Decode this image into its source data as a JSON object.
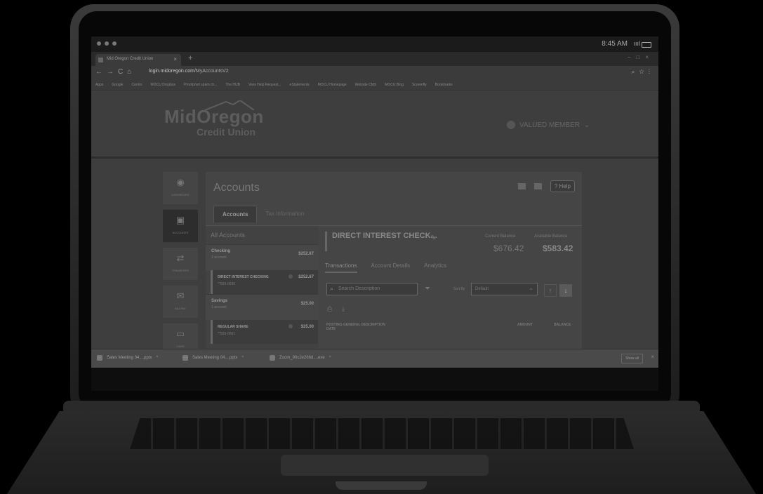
{
  "os": {
    "time": "8:45 AM",
    "signal": "ıııl"
  },
  "browser": {
    "tab_title": "Mid Oregon Credit Union",
    "tab_close": "×",
    "new_tab": "+",
    "url_host": "login.midoregon.com",
    "url_path": "/MyAccountsV2",
    "bookmarks": [
      "Apps",
      "Google",
      "Centro",
      "MOCU Dropbox",
      "Proofpoint spam ch...",
      "The HUB",
      "View Help Request...",
      "eStatements",
      "MOCU Homepage",
      "Website CMS",
      "MOCU Blog",
      "Screenfly",
      "Bookmarks"
    ]
  },
  "header": {
    "logo_line1": "MidOregon",
    "logo_line2": "Credit Union",
    "member_label": "VALUED MEMBER",
    "member_chevron": "⌄"
  },
  "sidenav": [
    {
      "label": "DASHBOARD",
      "icon": "◉"
    },
    {
      "label": "ACCOUNTS",
      "icon": "▣"
    },
    {
      "label": "TRANSFERS",
      "icon": "⇄"
    },
    {
      "label": "BILLPAY",
      "icon": "✉"
    },
    {
      "label": "CARD",
      "icon": "▭"
    }
  ],
  "accounts": {
    "title": "Accounts",
    "help": "Help",
    "tabs": [
      "Accounts",
      "Tax Information"
    ],
    "all_accounts": "All Accounts",
    "groups": [
      {
        "name": "Checking",
        "count": "1 account",
        "value": "$252.67",
        "sub": {
          "name": "DIRECT INTEREST CHECKING",
          "mask": "**555-0030",
          "value": "$252.67"
        }
      },
      {
        "name": "Savings",
        "count": "1 account",
        "value": "$25.00",
        "sub": {
          "name": "REGULAR SHARE",
          "mask": "**555-0061",
          "value": "$25.00"
        }
      }
    ],
    "detail": {
      "name": "DIRECT INTEREST CHECK...",
      "current_label": "Current Balance",
      "current_value": "$676.42",
      "available_label": "Available Balance",
      "available_value": "$583.42",
      "tabs": [
        "Transactions",
        "Account Details",
        "Analytics"
      ],
      "search_placeholder": "Search Description",
      "sort_label": "Sort By",
      "sort_value": "Default",
      "col_date": "POSTING DATE",
      "col_desc": "GENERAL DESCRIPTION",
      "col_amount": "AMOUNT",
      "col_balance": "BALANCE"
    }
  },
  "downloads": {
    "items": [
      "Sales Meeting 04....pptx",
      "Sales Meeting 04....pptx",
      "Zoom_90c2e266d....exe"
    ],
    "chevron": "^",
    "show_all": "Show all",
    "close": "×"
  }
}
